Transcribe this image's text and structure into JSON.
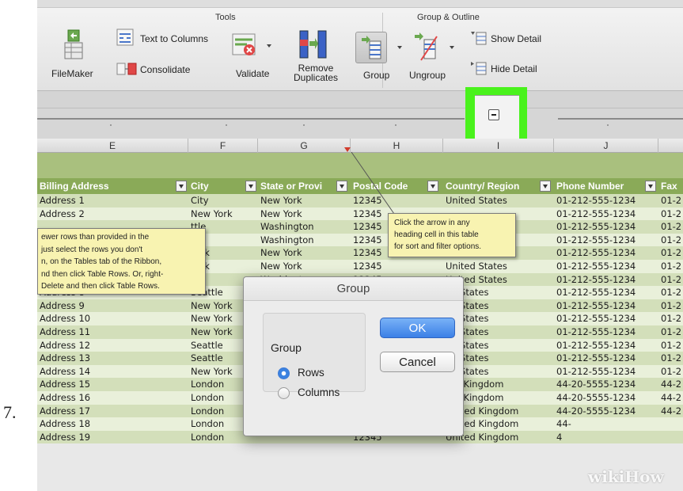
{
  "step_number": "7.",
  "ribbon": {
    "tools_title": "Tools",
    "group_outline_title": "Group & Outline",
    "filemaker": "FileMaker",
    "text_to_columns": "Text to Columns",
    "consolidate": "Consolidate",
    "validate": "Validate",
    "remove_duplicates_line1": "Remove",
    "remove_duplicates_line2": "Duplicates",
    "group": "Group",
    "ungroup": "Ungroup",
    "show_detail": "Show Detail",
    "hide_detail": "Hide Detail"
  },
  "column_letters": [
    "E",
    "F",
    "G",
    "H",
    "I",
    "J"
  ],
  "table_headers": [
    "Billing Address",
    "City",
    "State or Provi",
    "Postal Code",
    "Country/ Region",
    "Phone Number",
    "Fax"
  ],
  "rows": [
    [
      "Address 1",
      "City",
      "New York",
      "12345",
      "United States",
      "01-212-555-1234",
      "01-2"
    ],
    [
      "Address 2",
      "New York",
      "New York",
      "12345",
      "",
      "01-212-555-1234",
      "01-2"
    ],
    [
      "",
      "ttle",
      "Washington",
      "12345",
      "",
      "01-212-555-1234",
      "01-2"
    ],
    [
      "",
      "ttle",
      "Washington",
      "12345",
      "",
      "01-212-555-1234",
      "01-2"
    ],
    [
      "",
      "York",
      "New York",
      "12345",
      "United States",
      "01-212-555-1234",
      "01-2"
    ],
    [
      "",
      "York",
      "New York",
      "12345",
      "United States",
      "01-212-555-1234",
      "01-2"
    ],
    [
      "",
      "ttle",
      "Washington",
      "12345",
      "United States",
      "01-212-555-1234",
      "01-2"
    ],
    [
      "Address 8",
      "Seattle",
      "",
      "",
      "ed States",
      "01-212-555-1234",
      "01-2"
    ],
    [
      "Address 9",
      "New York",
      "",
      "",
      "ed States",
      "01-212-555-1234",
      "01-2"
    ],
    [
      "Address 10",
      "New York",
      "",
      "",
      "ed States",
      "01-212-555-1234",
      "01-2"
    ],
    [
      "Address 11",
      "New York",
      "",
      "",
      "ed States",
      "01-212-555-1234",
      "01-2"
    ],
    [
      "Address 12",
      "Seattle",
      "",
      "",
      "ed States",
      "01-212-555-1234",
      "01-2"
    ],
    [
      "Address 13",
      "Seattle",
      "",
      "",
      "ed States",
      "01-212-555-1234",
      "01-2"
    ],
    [
      "Address 14",
      "New York",
      "",
      "",
      "ed States",
      "01-212-555-1234",
      "01-2"
    ],
    [
      "Address 15",
      "London",
      "",
      "",
      "ted Kingdom",
      "44-20-5555-1234",
      "44-2"
    ],
    [
      "Address 16",
      "London",
      "",
      "",
      "ted Kingdom",
      "44-20-5555-1234",
      "44-2"
    ],
    [
      "Address 17",
      "London",
      "",
      "12345",
      "United Kingdom",
      "44-20-5555-1234",
      "44-2"
    ],
    [
      "Address 18",
      "London",
      "",
      "12345",
      "United Kingdom",
      "44-",
      ""
    ],
    [
      "Address 19",
      "London",
      "",
      "12345",
      "United Kingdom",
      "4",
      ""
    ]
  ],
  "comment_left": [
    "ewer rows than provided in the",
    "just select the rows you don't",
    "n, on the Tables tab of the Ribbon,",
    "nd then click Table Rows. Or, right-",
    "Delete and then click Table Rows."
  ],
  "comment_right": [
    "Click the arrow in any",
    "heading cell in this table",
    "for sort and filter options."
  ],
  "dialog": {
    "title": "Group",
    "group_label": "Group",
    "rows_label": "Rows",
    "columns_label": "Columns",
    "selected": "Rows",
    "ok": "OK",
    "cancel": "Cancel"
  },
  "watermark": {
    "wiki": "wiki",
    "how": "How"
  },
  "colors": {
    "highlight": "#49f21c",
    "table_header": "#8aaa58",
    "row_band_odd": "#d3dfba",
    "row_band_even": "#e9f0da",
    "comment": "#f8f3b1",
    "ok_button": "#3c80e6"
  }
}
